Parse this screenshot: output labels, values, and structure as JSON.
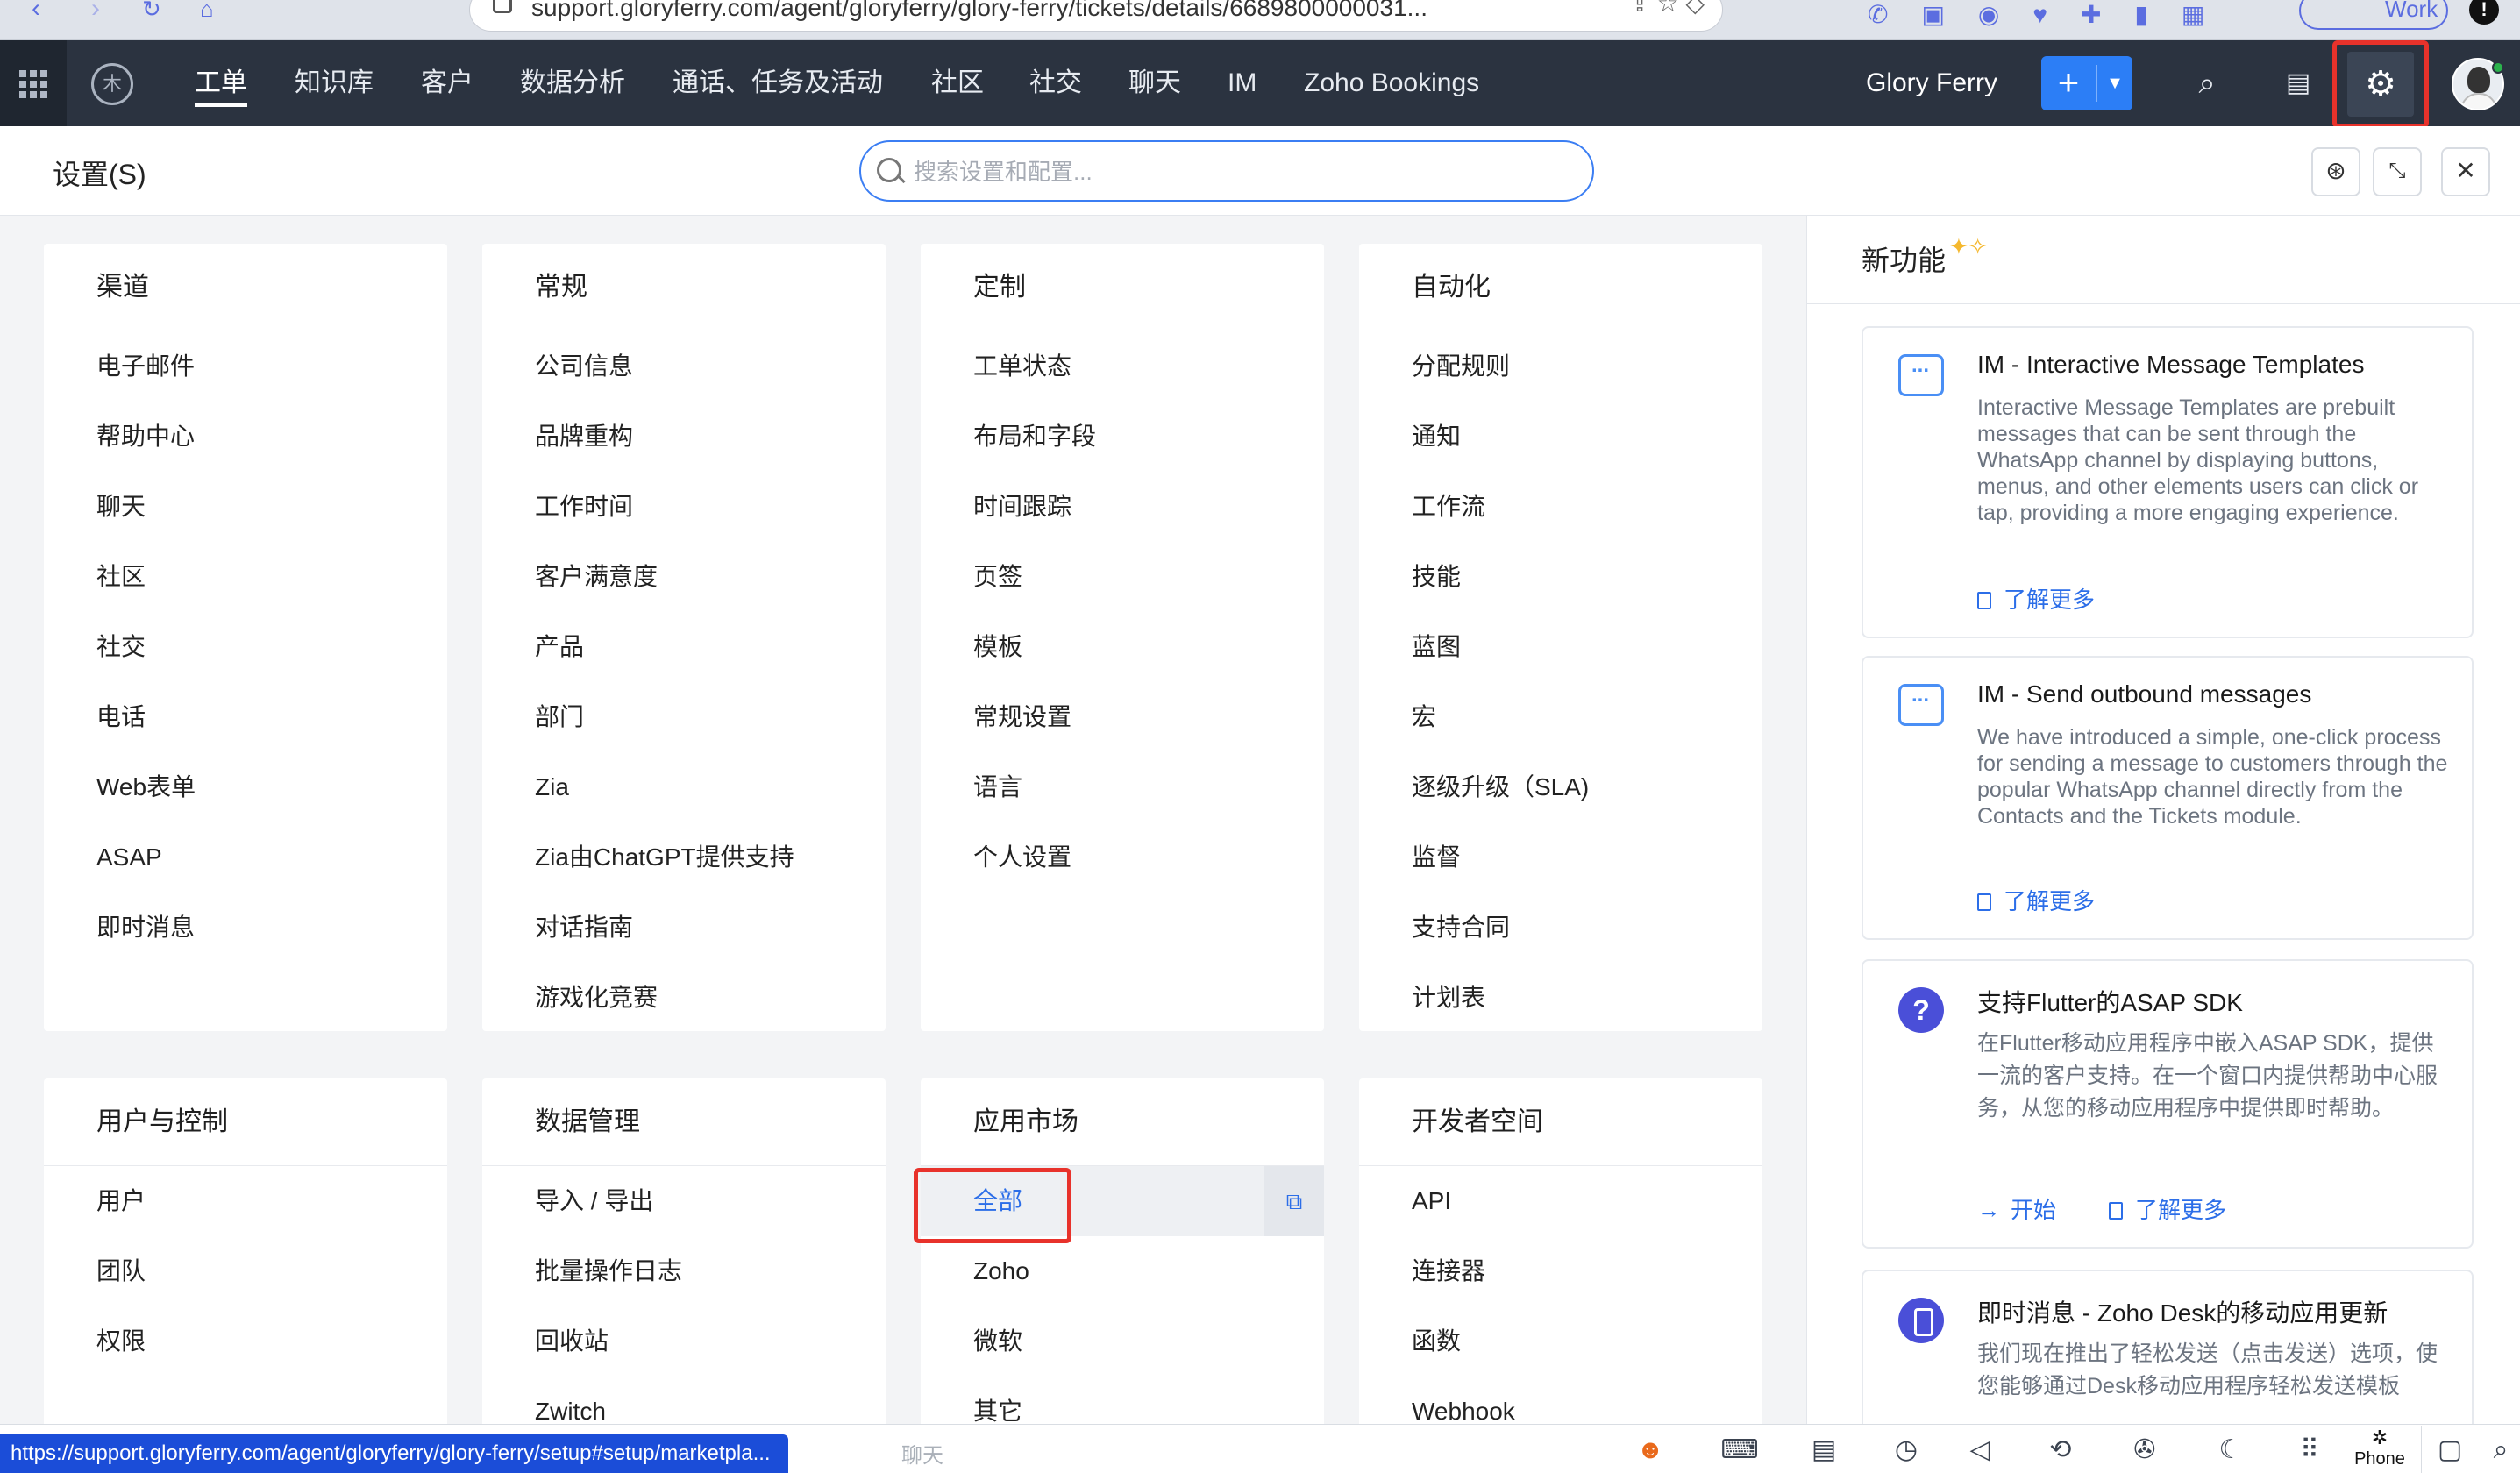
{
  "browser": {
    "url": "support.gloryferry.com/agent/gloryferry/glory-ferry/tickets/details/6689800000031...",
    "profile_label": "Work"
  },
  "topnav": {
    "logo_text": "木",
    "tabs": [
      {
        "label": "工单",
        "active": true
      },
      {
        "label": "知识库"
      },
      {
        "label": "客户"
      },
      {
        "label": "数据分析"
      },
      {
        "label": "通话、任务及活动"
      },
      {
        "label": "社区"
      },
      {
        "label": "社交"
      },
      {
        "label": "聊天"
      },
      {
        "label": "IM"
      },
      {
        "label": "Zoho Bookings"
      }
    ],
    "org_name": "Glory Ferry"
  },
  "settings": {
    "title": "设置(S)",
    "search_placeholder": "搜索设置和配置..."
  },
  "cards": [
    {
      "title": "渠道",
      "items": [
        "电子邮件",
        "帮助中心",
        "聊天",
        "社区",
        "社交",
        "电话",
        "Web表单",
        "ASAP",
        "即时消息"
      ]
    },
    {
      "title": "常规",
      "items": [
        "公司信息",
        "品牌重构",
        "工作时间",
        "客户满意度",
        "产品",
        "部门",
        "Zia",
        "Zia由ChatGPT提供支持",
        "对话指南",
        "游戏化竞赛"
      ]
    },
    {
      "title": "定制",
      "items": [
        "工单状态",
        "布局和字段",
        "时间跟踪",
        "页签",
        "模板",
        "常规设置",
        "语言",
        "个人设置"
      ]
    },
    {
      "title": "自动化",
      "items": [
        "分配规则",
        "通知",
        "工作流",
        "技能",
        "蓝图",
        "宏",
        "逐级升级（SLA)",
        "监督",
        "支持合同",
        "计划表"
      ]
    },
    {
      "title": "用户与控制",
      "items": [
        "用户",
        "团队",
        "权限"
      ]
    },
    {
      "title": "数据管理",
      "items": [
        "导入 / 导出",
        "批量操作日志",
        "回收站",
        "Zwitch"
      ]
    },
    {
      "title": "应用市场",
      "items": [
        "全部",
        "Zoho",
        "微软",
        "其它"
      ]
    },
    {
      "title": "开发者空间",
      "items": [
        "API",
        "连接器",
        "函数",
        "Webhook"
      ]
    }
  ],
  "whats_new": {
    "title": "新功能",
    "features": [
      {
        "title": "IM - Interactive Message Templates",
        "desc": "Interactive Message Templates are prebuilt messages that can be sent through the WhatsApp channel by displaying buttons, menus, and other elements users can click or tap, providing a more engaging experience.",
        "learn_more": "了解更多"
      },
      {
        "title": "IM - Send outbound messages",
        "desc": "We have introduced a simple, one-click process for sending a message to customers through the popular WhatsApp channel directly from the Contacts and the Tickets module.",
        "learn_more": "了解更多"
      },
      {
        "title": "支持Flutter的ASAP SDK",
        "desc": "在Flutter移动应用程序中嵌入ASAP SDK，提供一流的客户支持。在一个窗口内提供帮助中心服务，从您的移动应用程序中提供即时帮助。",
        "start": "开始",
        "learn_more": "了解更多"
      },
      {
        "title": "即时消息 - Zoho Desk的移动应用更新",
        "desc": "我们现在推出了轻松发送（点击发送）选项，使您能够通过Desk移动应用程序轻松发送模板"
      }
    ]
  },
  "statusbar": {
    "link_url": "https://support.gloryferry.com/agent/gloryferry/glory-ferry/setup#setup/marketpla...",
    "chat_label": "聊天",
    "phone_label": "Phone"
  }
}
